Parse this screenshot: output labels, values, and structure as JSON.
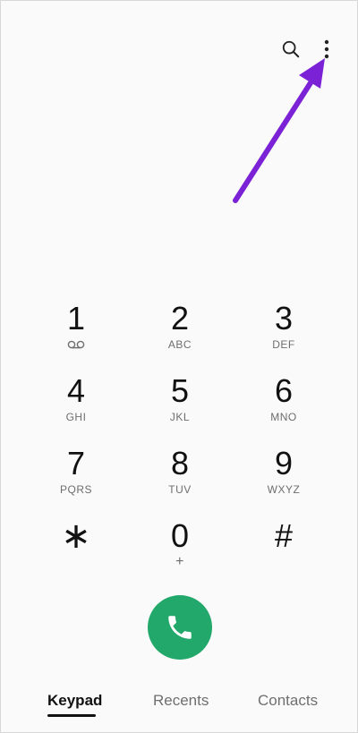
{
  "toolbar": {
    "search_icon": "search-icon",
    "more_icon": "more-vert-icon"
  },
  "keypad": {
    "keys": [
      {
        "digit": "1",
        "letters": "",
        "sub_icon": "voicemail-icon"
      },
      {
        "digit": "2",
        "letters": "ABC"
      },
      {
        "digit": "3",
        "letters": "DEF"
      },
      {
        "digit": "4",
        "letters": "GHI"
      },
      {
        "digit": "5",
        "letters": "JKL"
      },
      {
        "digit": "6",
        "letters": "MNO"
      },
      {
        "digit": "7",
        "letters": "PQRS"
      },
      {
        "digit": "8",
        "letters": "TUV"
      },
      {
        "digit": "9",
        "letters": "WXYZ"
      },
      {
        "digit": "∗",
        "letters": ""
      },
      {
        "digit": "0",
        "letters": "+"
      },
      {
        "digit": "#",
        "letters": ""
      }
    ]
  },
  "call": {
    "icon": "phone-icon",
    "color": "#22a86a"
  },
  "tabs": [
    {
      "label": "Keypad",
      "active": true
    },
    {
      "label": "Recents",
      "active": false
    },
    {
      "label": "Contacts",
      "active": false
    }
  ],
  "annotation": {
    "arrow_color": "#7b22d6"
  }
}
